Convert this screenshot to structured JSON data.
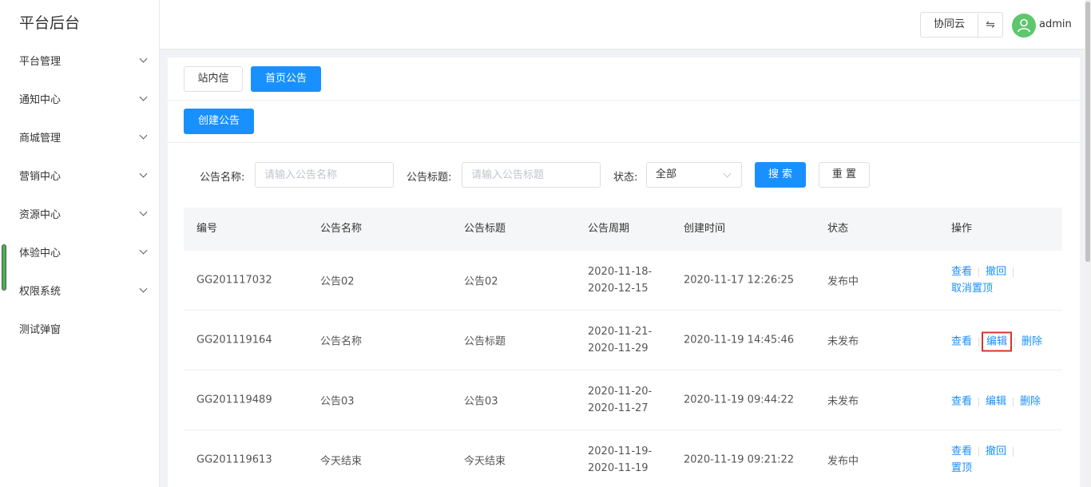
{
  "app": {
    "title": "平台后台"
  },
  "sidebar": {
    "items": [
      {
        "label": "平台管理",
        "expandable": true
      },
      {
        "label": "通知中心",
        "expandable": true
      },
      {
        "label": "商城管理",
        "expandable": true
      },
      {
        "label": "营销中心",
        "expandable": true
      },
      {
        "label": "资源中心",
        "expandable": true
      },
      {
        "label": "体验中心",
        "expandable": true
      },
      {
        "label": "权限系统",
        "expandable": true
      },
      {
        "label": "测试弹窗",
        "expandable": false
      }
    ]
  },
  "header": {
    "tenant": "协同云",
    "swap_icon": "⇋",
    "username": "admin",
    "avatar_color": "#5ec66d"
  },
  "tabs": [
    {
      "label": "站内信",
      "active": false
    },
    {
      "label": "首页公告",
      "active": true
    }
  ],
  "create_button": "创建公告",
  "filters": {
    "name_label": "公告名称:",
    "name_placeholder": "请输入公告名称",
    "title_label": "公告标题:",
    "title_placeholder": "请输入公告标题",
    "status_label": "状态:",
    "status_value": "全部",
    "search_button": "搜 索",
    "reset_button": "重 置"
  },
  "table": {
    "headers": [
      "编号",
      "公告名称",
      "公告标题",
      "公告周期",
      "创建时间",
      "状态",
      "操作"
    ],
    "rows": [
      {
        "id": "GG201117032",
        "name": "公告02",
        "title": "公告02",
        "period_start": "2020-11-18-",
        "period_end": "2020-12-15",
        "created": "2020-11-17 12:26:25",
        "status": "发布中",
        "actions": {
          "view": "查看",
          "revoke": "撤回",
          "pin": "取消置顶"
        }
      },
      {
        "id": "GG201119164",
        "name": "公告名称",
        "title": "公告标题",
        "period_start": "2020-11-21-",
        "period_end": "2020-11-29",
        "created": "2020-11-19 14:45:46",
        "status": "未发布",
        "actions": {
          "view": "查看",
          "edit": "编辑",
          "delete": "删除"
        }
      },
      {
        "id": "GG201119489",
        "name": "公告03",
        "title": "公告03",
        "period_start": "2020-11-20-",
        "period_end": "2020-11-27",
        "created": "2020-11-19 09:44:22",
        "status": "未发布",
        "actions": {
          "view": "查看",
          "edit": "编辑",
          "delete": "删除"
        }
      },
      {
        "id": "GG201119613",
        "name": "今天结束",
        "title": "今天结束",
        "period_start": "2020-11-19-",
        "period_end": "2020-11-19",
        "created": "2020-11-19 09:21:22",
        "status": "发布中",
        "actions": {
          "view": "查看",
          "revoke": "撤回",
          "pin": "置顶"
        }
      }
    ]
  },
  "colors": {
    "primary": "#1890ff",
    "highlight": "#d9332b"
  }
}
